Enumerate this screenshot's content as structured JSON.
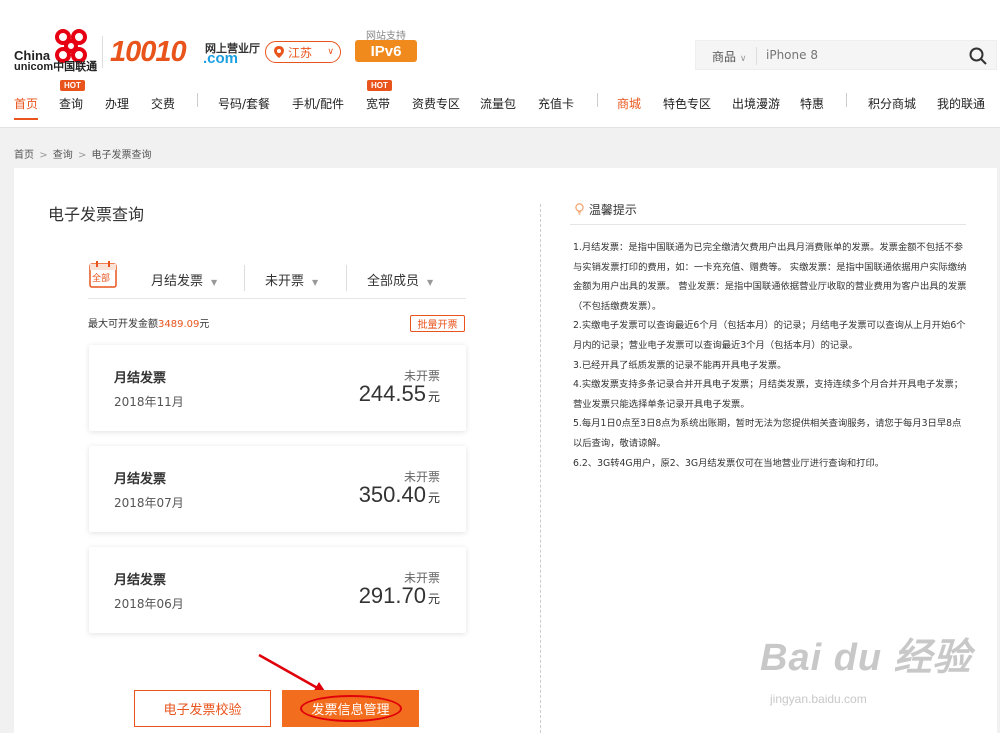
{
  "logo": {
    "line1": "China",
    "line2": "unicom中国联通"
  },
  "brand": {
    "number": "10010",
    "hall": "网上营业厅",
    "domain": ".com"
  },
  "province": {
    "label": "江苏"
  },
  "ipv6": {
    "support": "网站支持",
    "label": "IPv6"
  },
  "search": {
    "category": "商品",
    "placeholder": "iPhone 8"
  },
  "nav": {
    "items": [
      {
        "label": "首页"
      },
      {
        "label": "查询"
      },
      {
        "label": "办理"
      },
      {
        "label": "交费"
      },
      {
        "label": "号码/套餐"
      },
      {
        "label": "手机/配件"
      },
      {
        "label": "宽带"
      },
      {
        "label": "资费专区"
      },
      {
        "label": "流量包"
      },
      {
        "label": "充值卡"
      },
      {
        "label": "商城"
      },
      {
        "label": "特色专区"
      },
      {
        "label": "出境漫游"
      },
      {
        "label": "特惠"
      },
      {
        "label": "积分商城"
      },
      {
        "label": "我的联通"
      }
    ],
    "hot": "HOT"
  },
  "breadcrumb": {
    "home": "首页",
    "query": "查询",
    "current": "电子发票查询",
    "sep": ">"
  },
  "page": {
    "title": "电子发票查询"
  },
  "filters": {
    "all": "全部",
    "type": "月结发票",
    "status": "未开票",
    "member": "全部成员"
  },
  "summary": {
    "label": "最大可开发金额",
    "amount": "3489.09",
    "unit": "元",
    "batch": "批量开票"
  },
  "invoices": [
    {
      "name": "月结发票",
      "date": "2018年11月",
      "status": "未开票",
      "amount": "244.55",
      "unit": "元"
    },
    {
      "name": "月结发票",
      "date": "2018年07月",
      "status": "未开票",
      "amount": "350.40",
      "unit": "元"
    },
    {
      "name": "月结发票",
      "date": "2018年06月",
      "status": "未开票",
      "amount": "291.70",
      "unit": "元"
    }
  ],
  "buttons": {
    "verify": "电子发票校验",
    "manage": "发票信息管理"
  },
  "tips": {
    "title": "温馨提示",
    "items": [
      "1.月结发票：是指中国联通为已完全缴清欠费用户出具月消费账单的发票。发票金额不包括不参与实销发票打印的费用，如：一卡充充值、赠费等。 实缴发票：是指中国联通依据用户实际缴纳金额为用户出具的发票。 营业发票：是指中国联通依据营业厅收取的营业费用为客户出具的发票（不包括缴费发票）。",
      "2.实缴电子发票可以查询最近6个月（包括本月）的记录；月结电子发票可以查询从上月开始6个月内的记录；营业电子发票可以查询最近3个月（包括本月）的记录。",
      "3.已经开具了纸质发票的记录不能再开具电子发票。",
      "4.实缴发票支持多条记录合并开具电子发票；月结类发票，支持连续多个月合并开具电子发票；营业发票只能选择单条记录开具电子发票。",
      "5.每月1日0点至3日8点为系统出账期，暂时无法为您提供相关查询服务，请您于每月3日早8点以后查询，敬请谅解。",
      "6.2、3G转4G用户，原2、3G月结发票仅可在当地营业厅进行查询和打印。"
    ]
  },
  "watermark": {
    "brand": "Bai du 经验",
    "url": "jingyan.baidu.com"
  },
  "colors": {
    "accent": "#e9541c",
    "button": "#f36d1e",
    "annotation": "#e0000a"
  }
}
